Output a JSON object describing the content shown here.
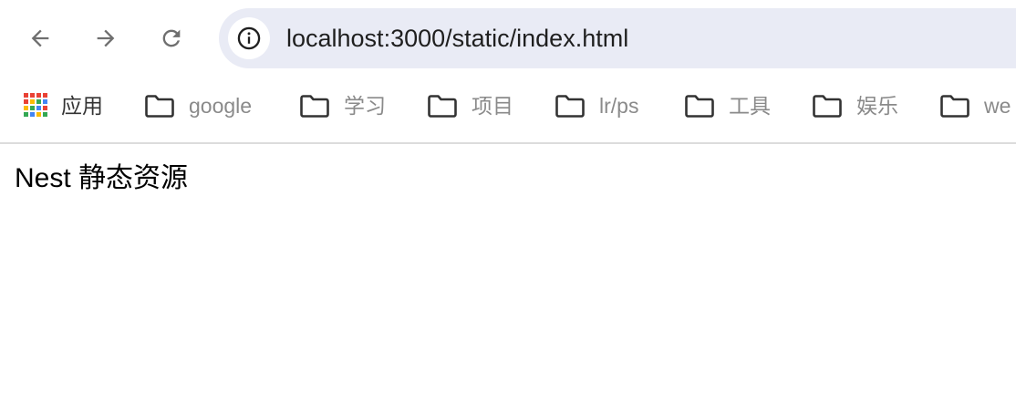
{
  "toolbar": {
    "url": "localhost:3000/static/index.html"
  },
  "bookmarks": {
    "apps_label": "应用",
    "items": [
      {
        "label": "google"
      },
      {
        "label": "学习"
      },
      {
        "label": "项目"
      },
      {
        "label": "lr/ps"
      },
      {
        "label": "工具"
      },
      {
        "label": "娱乐"
      },
      {
        "label": "we"
      }
    ]
  },
  "page": {
    "text": "Nest 静态资源"
  },
  "colors": {
    "omnibox_bg": "#e9ebf5",
    "nav_icon": "#6f6f6f",
    "bookmark_text": "#8a8a8a",
    "apps_grid": [
      "#e94235",
      "#fbbc05",
      "#34a853",
      "#4285f4"
    ]
  }
}
